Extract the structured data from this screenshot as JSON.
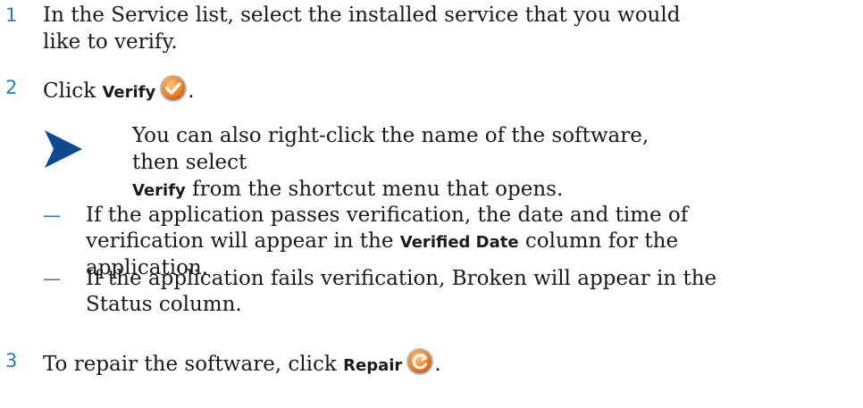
{
  "steps": [
    {
      "number": "1",
      "text": "In the Service list, select the installed service that you would like to verify."
    },
    {
      "number": "2",
      "prefix": "Click ",
      "bold": "Verify",
      "suffix": ".",
      "icon": "verify-checkmark-icon"
    },
    {
      "number": "3",
      "prefix": "To repair the software, click ",
      "bold": "Repair",
      "suffix": ".",
      "icon": "repair-arrow-icon"
    }
  ],
  "note": {
    "icon": "note-arrow-icon",
    "line1": "You can also right-click the name of the software, then select",
    "bold": "Verify",
    "line2_suffix": " from the shortcut menu that opens."
  },
  "bullets": [
    {
      "dash": "—",
      "prefix": "If the application passes verification, the date and time of verification will appear in the ",
      "bold": "Verified Date",
      "suffix": " column for the application."
    },
    {
      "dash": "—",
      "text": "If the application fails verification, Broken will appear in the Status column."
    }
  ],
  "colors": {
    "accent": "#1f7fb8",
    "icon_orange": "#f08a2c",
    "note_arrow": "#0d4a8f"
  }
}
